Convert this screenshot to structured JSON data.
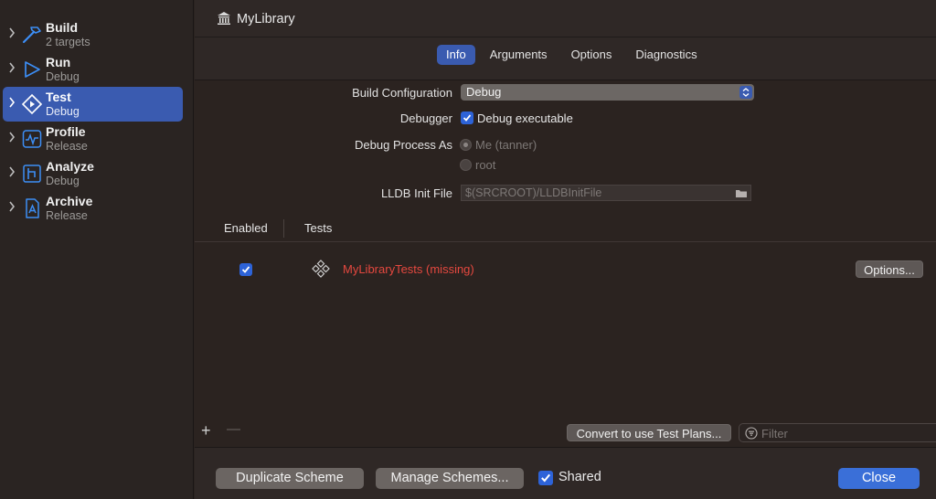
{
  "sidebar": {
    "items": [
      {
        "name": "Build",
        "sub": "2 targets",
        "icon": "hammer-icon"
      },
      {
        "name": "Run",
        "sub": "Debug",
        "icon": "play-icon"
      },
      {
        "name": "Test",
        "sub": "Debug",
        "icon": "test-diamond-icon",
        "selected": true
      },
      {
        "name": "Profile",
        "sub": "Release",
        "icon": "waveform-icon"
      },
      {
        "name": "Analyze",
        "sub": "Debug",
        "icon": "analyze-icon"
      },
      {
        "name": "Archive",
        "sub": "Release",
        "icon": "archive-icon"
      }
    ]
  },
  "header": {
    "target_name": "MyLibrary",
    "tabs": [
      {
        "label": "Info",
        "active": true
      },
      {
        "label": "Arguments"
      },
      {
        "label": "Options"
      },
      {
        "label": "Diagnostics"
      }
    ]
  },
  "form": {
    "build_config_label": "Build Configuration",
    "build_config_value": "Debug",
    "debugger_label": "Debugger",
    "debug_executable_label": "Debug executable",
    "debug_process_label": "Debug Process As",
    "process_me": "Me (tanner)",
    "process_root": "root",
    "lldb_label": "LLDB Init File",
    "lldb_placeholder": "$(SRCROOT)/LLDBInitFile"
  },
  "tests_table": {
    "col_enabled": "Enabled",
    "col_tests": "Tests",
    "rows": [
      {
        "name": "MyLibraryTests (missing)",
        "enabled": true,
        "options_label": "Options..."
      }
    ]
  },
  "toolbar": {
    "plus": "+",
    "minus": "—",
    "convert_label": "Convert to use Test Plans...",
    "filter_placeholder": "Filter"
  },
  "footer": {
    "duplicate_label": "Duplicate Scheme",
    "manage_label": "Manage Schemes...",
    "shared_label": "Shared",
    "close_label": "Close"
  },
  "colors": {
    "accent": "#3a5bb0",
    "missing_red": "#e5483f",
    "checkbox_blue": "#2d63d8"
  }
}
